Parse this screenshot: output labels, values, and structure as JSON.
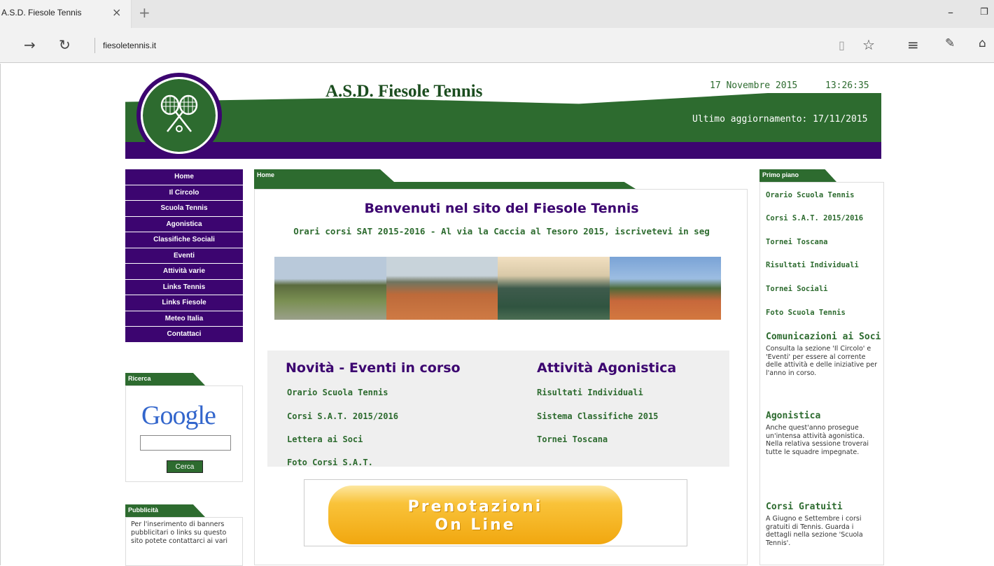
{
  "browser": {
    "tab_title": "A.S.D. Fiesole Tennis",
    "tab_close": "×",
    "new_tab": "+",
    "minimize": "–",
    "maximize": "❐",
    "address": "fiesoletennis.it",
    "back": "←",
    "forward": "→",
    "refresh": "↻",
    "reading_view": "▯",
    "favorite": "☆",
    "hub": "≡",
    "note": "✎",
    "share": "⌂"
  },
  "header": {
    "title": "A.S.D. Fiesole Tennis",
    "date": "17 Novembre 2015",
    "time": "13:26:35",
    "updated": "Ultimo aggiornamento: 17/11/2015"
  },
  "menu": [
    "Home",
    "Il Circolo",
    "Scuola Tennis",
    "Agonistica",
    "Classifiche Sociali",
    "Eventi",
    "Attività varie",
    "Links Tennis",
    "Links Fiesole",
    "Meteo Italia",
    "Contattaci"
  ],
  "search": {
    "tab": "Ricerca",
    "google": "Google",
    "button": "Cerca"
  },
  "ads": {
    "tab": "Pubblicità",
    "text": "Per l'inserimento di banners pubblicitari o links su questo sito potete contattarci ai vari"
  },
  "center": {
    "tab": "Home",
    "welcome": "Benvenuti nel sito del Fiesole Tennis",
    "ticker": "Orari corsi SAT 2015-2016 - Al via la Caccia al Tesoro 2015, iscrivetevi in seg",
    "news_title": "Novità - Eventi in corso",
    "news_links": [
      "Orario Scuola Tennis",
      "Corsi S.A.T. 2015/2016",
      "Lettera ai Soci",
      "Foto Corsi S.A.T."
    ],
    "agon_title": "Attività Agonistica",
    "agon_links": [
      "Risultati Individuali",
      "Sistema Classifiche 2015",
      "Tornei Toscana"
    ],
    "promo_line1": "Prenotazioni",
    "promo_line2": "On Line"
  },
  "right": {
    "tab": "Primo piano",
    "links": [
      "Orario Scuola Tennis",
      "Corsi S.A.T. 2015/2016",
      "Tornei Toscana",
      "Risultati Individuali",
      "Tornei Sociali",
      "Foto Scuola Tennis"
    ],
    "sections": [
      {
        "title": "Comunicazioni ai Soci",
        "text": "Consulta la sezione 'Il Circolo' e 'Eventi' per essere al corrente delle attività e delle iniziative per l'anno in corso."
      },
      {
        "title": "Agonistica",
        "text": "Anche quest'anno prosegue un'intensa attività agonistica. Nella relativa sessione troverai tutte le squadre impegnate."
      },
      {
        "title": "Corsi Gratuiti",
        "text": "A Giugno e Settembre i corsi gratuiti di Tennis. Guarda i dettagli nella sezione 'Scuola Tennis'."
      }
    ]
  },
  "colors": {
    "green": "#2d6b2f",
    "purple": "#3c0570",
    "orange": "#f1a70f"
  }
}
